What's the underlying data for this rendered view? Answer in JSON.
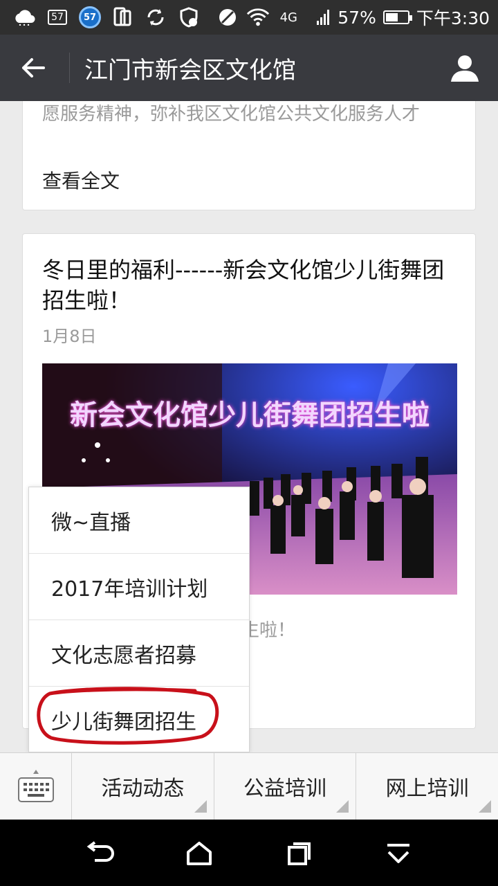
{
  "status_bar": {
    "notification_badge": "57",
    "app_badge": "57",
    "network": "4G",
    "battery_percent": "57%",
    "battery_level": 0.57,
    "time": "下午3:30"
  },
  "header": {
    "title": "江门市新会区文化馆"
  },
  "previous_article": {
    "text": "愿服务精神，弥补我区文化馆公共文化服务人才",
    "read_more": "查看全文"
  },
  "article": {
    "title": "冬日里的福利------新会文化馆少儿街舞团招生啦！",
    "date": "1月8日",
    "cover_caption": "新会文化馆少儿街舞团招生啦",
    "summary": "招生啦！"
  },
  "popup_menu": {
    "items": [
      {
        "label": "微~直播"
      },
      {
        "label": "2017年培训计划"
      },
      {
        "label": "文化志愿者招募"
      },
      {
        "label": "少儿街舞团招生"
      }
    ],
    "highlighted_index": 3,
    "highlight_color": "#c8101a"
  },
  "bottom_menu": {
    "tabs": [
      {
        "label": "活动动态"
      },
      {
        "label": "公益培训"
      },
      {
        "label": "网上培训"
      }
    ]
  }
}
